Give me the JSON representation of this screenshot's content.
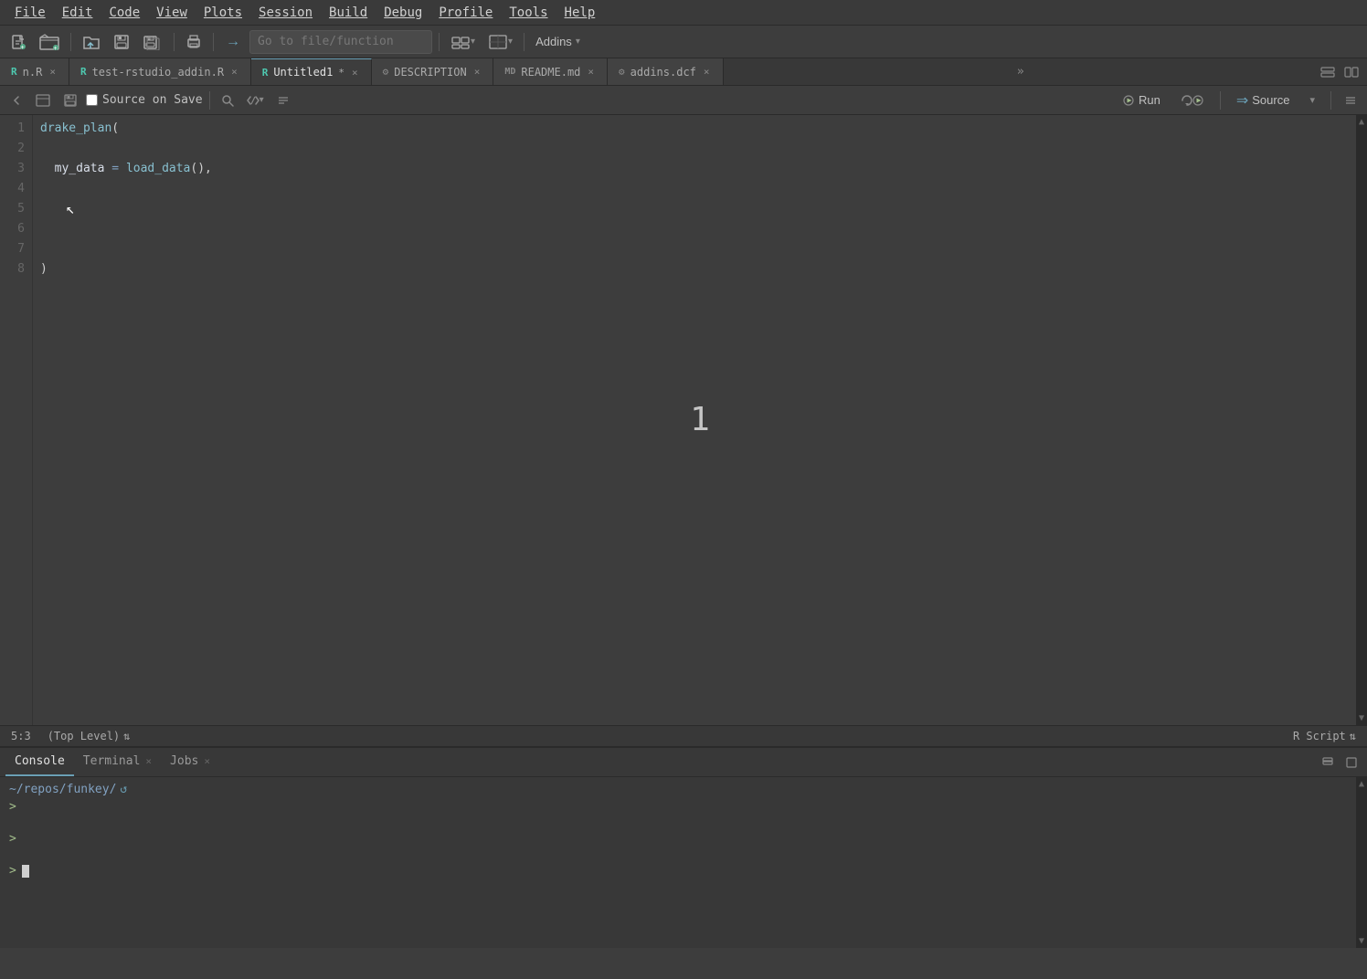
{
  "menu": {
    "items": [
      "File",
      "Edit",
      "Code",
      "View",
      "Plots",
      "Session",
      "Build",
      "Debug",
      "Profile",
      "Tools",
      "Help"
    ]
  },
  "toolbar": {
    "goto_placeholder": "Go to file/function",
    "addins_label": "Addins"
  },
  "tabs": [
    {
      "id": "nr",
      "label": "n.R",
      "icon": "R",
      "active": false,
      "modified": false
    },
    {
      "id": "test-rstudio-addin",
      "label": "test-rstudio_addin.R",
      "icon": "R",
      "active": false,
      "modified": false
    },
    {
      "id": "untitled1",
      "label": "Untitled1",
      "icon": "R",
      "active": true,
      "modified": true
    },
    {
      "id": "description",
      "label": "DESCRIPTION",
      "icon": "gear",
      "active": false,
      "modified": false
    },
    {
      "id": "readme",
      "label": "README.md",
      "icon": "md",
      "active": false,
      "modified": false
    },
    {
      "id": "addins-dcf",
      "label": "addins.dcf",
      "icon": "gear",
      "active": false,
      "modified": false
    }
  ],
  "editor_toolbar": {
    "source_on_save_label": "Source on Save",
    "run_label": "Run",
    "source_label": "Source"
  },
  "code": {
    "lines": [
      {
        "num": 1,
        "text": "drake_plan("
      },
      {
        "num": 2,
        "text": ""
      },
      {
        "num": 3,
        "text": "  my_data = load_data(),"
      },
      {
        "num": 4,
        "text": ""
      },
      {
        "num": 5,
        "text": ""
      },
      {
        "num": 6,
        "text": ""
      },
      {
        "num": 7,
        "text": ""
      },
      {
        "num": 8,
        "text": ")"
      }
    ]
  },
  "status_bar": {
    "position": "5:3",
    "scope": "(Top Level)",
    "file_type": "R Script"
  },
  "bottom_panel": {
    "tabs": [
      {
        "id": "console",
        "label": "Console",
        "active": true,
        "closeable": false
      },
      {
        "id": "terminal",
        "label": "Terminal",
        "active": false,
        "closeable": true
      },
      {
        "id": "jobs",
        "label": "Jobs",
        "active": false,
        "closeable": true
      }
    ],
    "console": {
      "path": "~/repos/funkey/",
      "prompts": [
        ">",
        ">",
        ">"
      ]
    }
  },
  "big_number": "1",
  "icons": {
    "search": "🔍",
    "save": "💾",
    "run": "▶",
    "source": "⇒",
    "menu_more": "»",
    "refresh": "↺",
    "chevron_down": "▾",
    "settings": "⚙",
    "collapse": "◫",
    "expand": "▣",
    "cursor": "↖",
    "close": "×",
    "new_file": "📄",
    "open_file": "📂",
    "save_all": "💾",
    "undo": "↩",
    "redo": "↪"
  }
}
